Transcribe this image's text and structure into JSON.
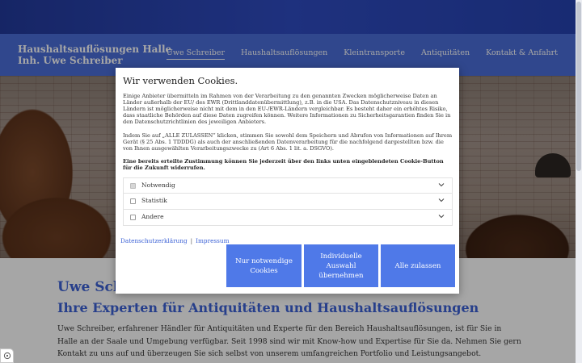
{
  "site": {
    "brand_line1": "Haushaltsauflösungen Halle",
    "brand_line2": "Inh. Uwe Schreiber"
  },
  "nav": {
    "items": [
      {
        "label": "Uwe Schreiber",
        "active": true
      },
      {
        "label": "Haushaltsauflösungen",
        "active": false
      },
      {
        "label": "Kleintransporte",
        "active": false
      },
      {
        "label": "Antiquitäten",
        "active": false
      },
      {
        "label": "Kontakt & Anfahrt",
        "active": false
      }
    ]
  },
  "content": {
    "title": "Uwe Schreiber",
    "subtitle": "Ihre Experten für Antiquitäten und Haushaltsauflösungen",
    "body": "Uwe Schreiber, erfahrener Händler für Antiquitäten und Experte für den Bereich Haushaltsauflösungen, ist für Sie in Halle an der Saale und Umgebung verfügbar. Seit 1998 sind wir mit Know-how und Expertise für Sie da. Nehmen Sie gern Kontakt zu uns auf und überzeugen Sie sich selbst von unserem umfangreichen Portfolio und Leistungsangebot."
  },
  "cookie_dialog": {
    "title": "Wir verwenden Cookies.",
    "paragraph1": "Einige Anbieter übermitteln im Rahmen von der Verarbeitung zu den genannten Zwecken möglicherweise Daten an Länder außerhalb der EU/ des EWR (Drittlanddatenübermittlung), z.B. in die USA. Das Datenschutzniveau in diesen Ländern ist möglicherweise nicht mit dem in den EU-/EWR-Ländern vergleichbar. Es besteht daher ein erhöhtes Risiko, dass staatliche Behörden auf diese Daten zugreifen können. Weitere Informationen zu Sicherheitsgarantien finden Sie in den Datenschutzrichtlinien des jeweiligen Anbieters.",
    "paragraph2": "Indem Sie auf „ALLE ZULASSEN“ klicken, stimmen Sie sowohl dem Speichern und Abrufen von Informationen auf Ihrem Gerät (§ 25 Abs. 1 TDDDG) als auch der anschließenden Datenverarbeitung für die nachfolgend dargestellten bzw. die von Ihnen ausgewählten Verarbeitungszwecke zu (Art 6 Abs. 1 lit. a. DSGVO).",
    "paragraph3": "Eine bereits erteilte Zustimmung können Sie jederzeit über den links unten eingeblendeten Cookie-Button für die Zukunft widerrufen.",
    "options": [
      {
        "label": "Notwendig",
        "checked": true,
        "disabled": true
      },
      {
        "label": "Statistik",
        "checked": false,
        "disabled": false
      },
      {
        "label": "Andere",
        "checked": false,
        "disabled": false
      }
    ],
    "privacy_link": "Datenschutzerklärung",
    "link_separator": "|",
    "imprint_link": "Impressum",
    "btn_necessary": "Nur notwendige Cookies",
    "btn_individual": "Individuelle Auswahl übernehmen",
    "btn_all": "Alle zulassen"
  },
  "colors": {
    "accent": "#3c62d6",
    "button": "#4f79e8",
    "header": "#3c62d6"
  }
}
